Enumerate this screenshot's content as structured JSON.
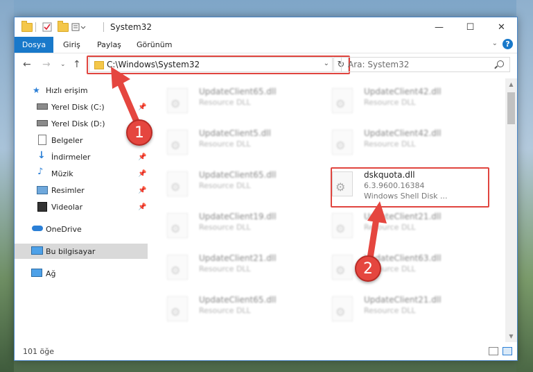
{
  "window": {
    "title": "System32",
    "controls": {
      "minimize": "—",
      "maximize": "☐",
      "close": "✕"
    }
  },
  "ribbon": {
    "tabs": [
      "Dosya",
      "Giriş",
      "Paylaş",
      "Görünüm"
    ],
    "help": "?"
  },
  "navigation": {
    "address": "C:\\Windows\\System32",
    "search_placeholder": "Ara: System32"
  },
  "sidebar": {
    "quick_access": "Hızlı erişim",
    "items": [
      {
        "label": "Yerel Disk (C:)",
        "icon": "drive-icon",
        "pinned": true
      },
      {
        "label": "Yerel Disk (D:)",
        "icon": "drive-icon",
        "pinned": false
      },
      {
        "label": "Belgeler",
        "icon": "documents-icon",
        "pinned": true
      },
      {
        "label": "İndirmeler",
        "icon": "download-icon",
        "pinned": true
      },
      {
        "label": "Müzik",
        "icon": "music-icon",
        "pinned": true
      },
      {
        "label": "Resimler",
        "icon": "pictures-icon",
        "pinned": true
      },
      {
        "label": "Videolar",
        "icon": "videos-icon",
        "pinned": true
      }
    ],
    "onedrive": "OneDrive",
    "this_pc": "Bu bilgisayar",
    "network": "Ağ"
  },
  "files": [
    {
      "name": "UpdateClient65.dll",
      "sub": "Resource DLL"
    },
    {
      "name": "UpdateClient42.dll",
      "sub": "Resource DLL"
    },
    {
      "name": "UpdateClient5.dll",
      "sub": "Resource DLL"
    },
    {
      "name": "UpdateClient42.dll",
      "sub": "Resource DLL"
    },
    {
      "name": "UpdateClient65.dll",
      "sub": "Resource DLL"
    },
    {
      "name": "dskquota.dll",
      "sub": "6.3.9600.16384",
      "sub2": "Windows Shell Disk ..."
    },
    {
      "name": "UpdateClient19.dll",
      "sub": "Resource DLL"
    },
    {
      "name": "UpdateClient21.dll",
      "sub": "Resource DLL"
    },
    {
      "name": "UpdateClient21.dll",
      "sub": "Resource DLL"
    },
    {
      "name": "UpdateClient63.dll",
      "sub": "Resource DLL"
    },
    {
      "name": "UpdateClient65.dll",
      "sub": "Resource DLL"
    },
    {
      "name": "UpdateClient21.dll",
      "sub": "Resource DLL"
    }
  ],
  "status": {
    "count": "101 öğe"
  },
  "annotations": {
    "step1": "1",
    "step2": "2"
  },
  "colors": {
    "accent": "#1979ca",
    "highlight": "#e0443e"
  }
}
